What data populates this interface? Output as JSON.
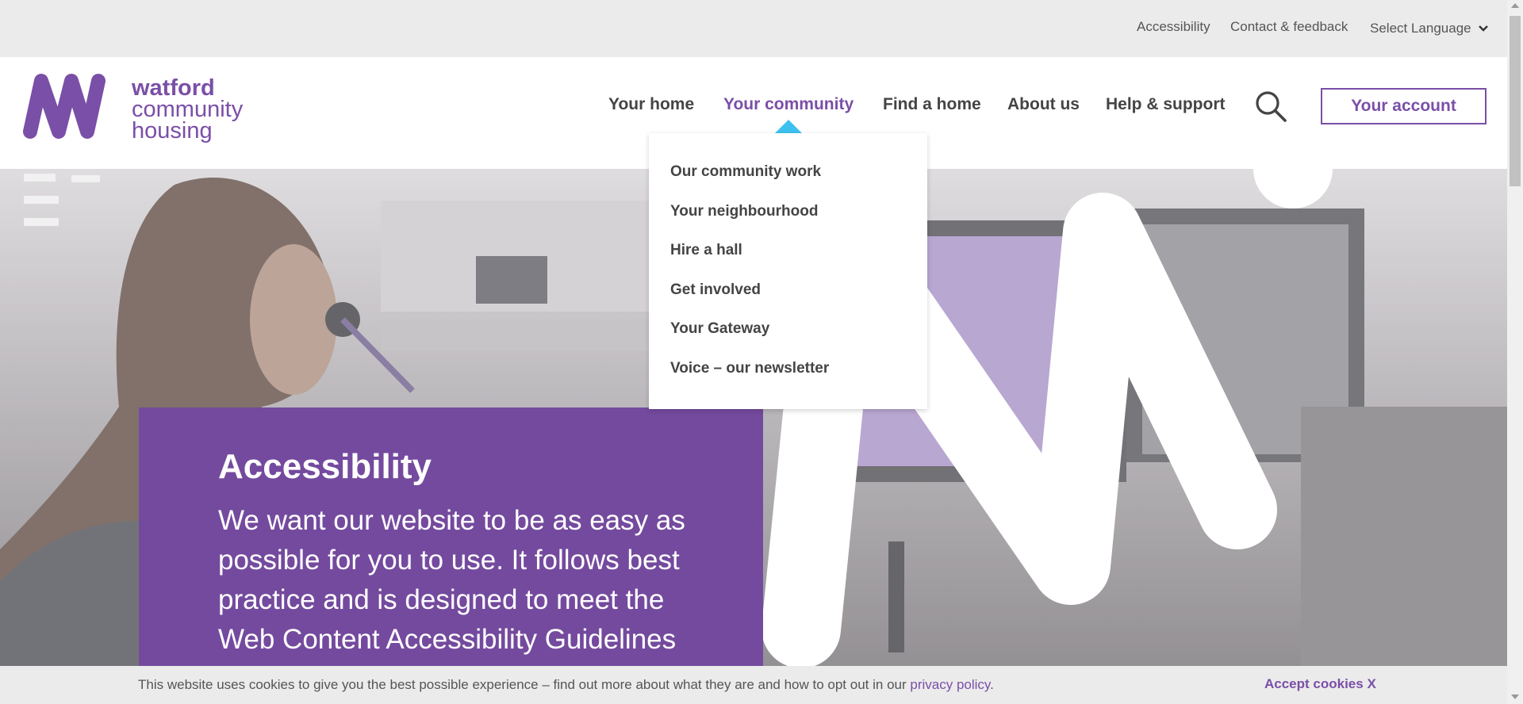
{
  "utility_bar": {
    "links": [
      "Accessibility",
      "Contact & feedback"
    ],
    "language_label": "Select Language"
  },
  "logo": {
    "line1": "watford",
    "line2": "community",
    "line3": "housing"
  },
  "nav": {
    "items": [
      "Your home",
      "Your community",
      "Find a home",
      "About us",
      "Help & support"
    ],
    "active": "Your community",
    "account_label": "Your account"
  },
  "dropdown": {
    "items": [
      "Our community work",
      "Your neighbourhood",
      "Hire a hall",
      "Get involved",
      "Your Gateway",
      "Voice – our newsletter"
    ]
  },
  "hero": {
    "title": "Accessibility",
    "body": "We want our website to be as easy as possible for you to use. It follows best practice and is designed to meet the Web Content Accessibility Guidelines AA"
  },
  "cookie_bar": {
    "text": "This website uses cookies to give you the best possible experience – find out more about what they are and how to opt out in our",
    "link_label": "privacy policy",
    "suffix": ".",
    "accept_label": "Accept cookies X"
  },
  "colors": {
    "brand_purple": "#7a4fa7",
    "hero_purple": "#744a9e",
    "caret_blue": "#3dc1ee",
    "utility_grey": "#ebebeb"
  },
  "icons": [
    "chevron-down-icon",
    "search-icon",
    "logo-mark"
  ]
}
